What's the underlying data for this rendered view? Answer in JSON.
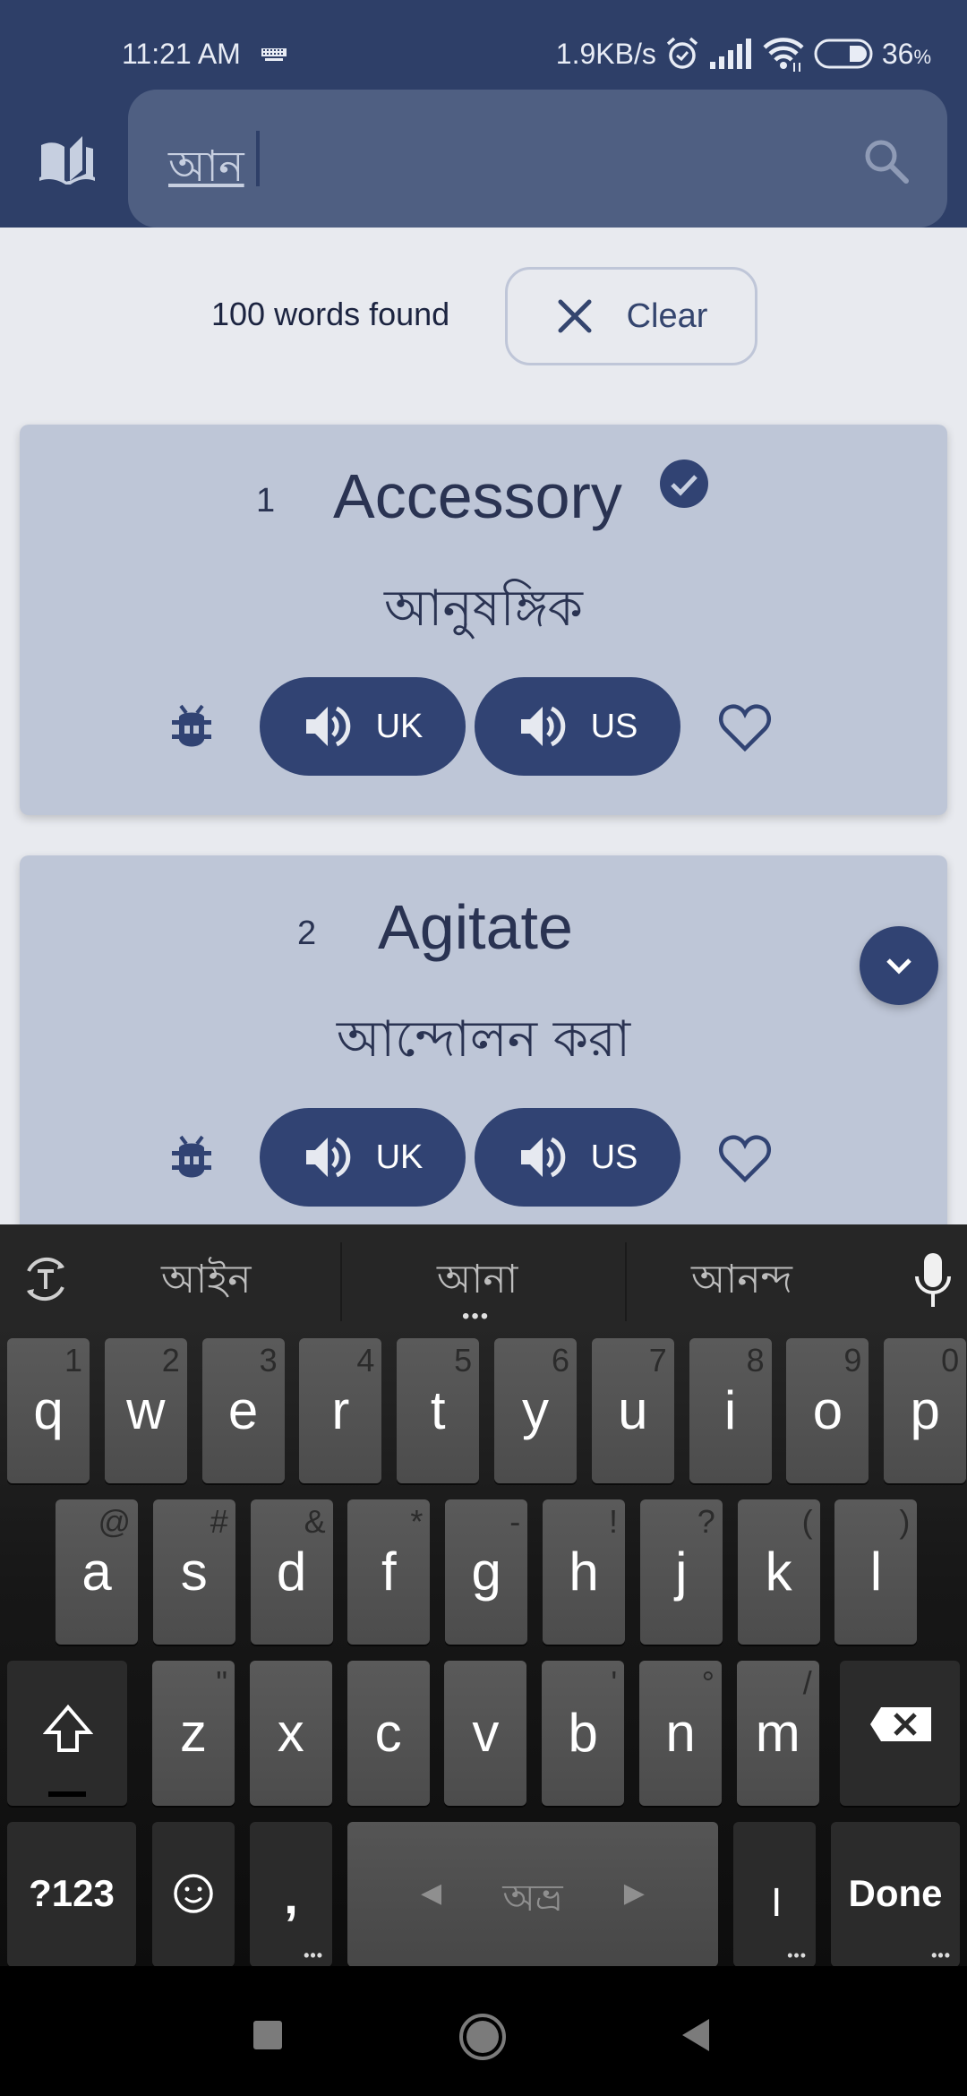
{
  "status_bar": {
    "time": "11:21 AM",
    "network_speed": "1.9KB/s",
    "battery": "36",
    "battery_unit": "%",
    "battery_level": 0.36,
    "icons": [
      "keyboard-icon",
      "alarm-icon",
      "signal-icon",
      "wifi-icon",
      "battery-icon"
    ]
  },
  "app_bar": {
    "logo_icon": "book-open-icon",
    "search": {
      "value": "আন",
      "icon": "search-icon"
    }
  },
  "results": {
    "count_text": "100 words found",
    "clear_label": "Clear"
  },
  "words": [
    {
      "number": "1",
      "word": "Accessory",
      "translation": "আনুষঙ্গিক",
      "learned": true,
      "uk_label": "UK",
      "us_label": "US",
      "favorite": false
    },
    {
      "number": "2",
      "word": "Agitate",
      "translation": "আন্দোলন করা",
      "learned": false,
      "uk_label": "UK",
      "us_label": "US",
      "favorite": false
    }
  ],
  "theme": {
    "primary": "#2e3f68",
    "button": "#314373",
    "card": "#bec6d7",
    "background": "#e8eaef"
  },
  "keyboard": {
    "suggestions": [
      "আইন",
      "আনা",
      "আনন্দ"
    ],
    "row1": [
      {
        "key": "q",
        "hint": "1"
      },
      {
        "key": "w",
        "hint": "2"
      },
      {
        "key": "e",
        "hint": "3"
      },
      {
        "key": "r",
        "hint": "4"
      },
      {
        "key": "t",
        "hint": "5"
      },
      {
        "key": "y",
        "hint": "6"
      },
      {
        "key": "u",
        "hint": "7"
      },
      {
        "key": "i",
        "hint": "8"
      },
      {
        "key": "o",
        "hint": "9"
      },
      {
        "key": "p",
        "hint": "0"
      }
    ],
    "row2": [
      {
        "key": "a",
        "hint": "@"
      },
      {
        "key": "s",
        "hint": "#"
      },
      {
        "key": "d",
        "hint": "&"
      },
      {
        "key": "f",
        "hint": "*"
      },
      {
        "key": "g",
        "hint": "-"
      },
      {
        "key": "h",
        "hint": "!"
      },
      {
        "key": "j",
        "hint": "?"
      },
      {
        "key": "k",
        "hint": "("
      },
      {
        "key": "l",
        "hint": ")"
      }
    ],
    "row3": [
      {
        "key": "z",
        "hint": "\""
      },
      {
        "key": "x",
        "hint": ""
      },
      {
        "key": "c",
        "hint": ""
      },
      {
        "key": "v",
        "hint": ""
      },
      {
        "key": "b",
        "hint": "'"
      },
      {
        "key": "n",
        "hint": "°"
      },
      {
        "key": "m",
        "hint": "/"
      }
    ],
    "symbols_label": "?123",
    "comma": ",",
    "space_label": "অভ্র",
    "danda": "।",
    "done_label": "Done",
    "more_indicator": "•••"
  }
}
